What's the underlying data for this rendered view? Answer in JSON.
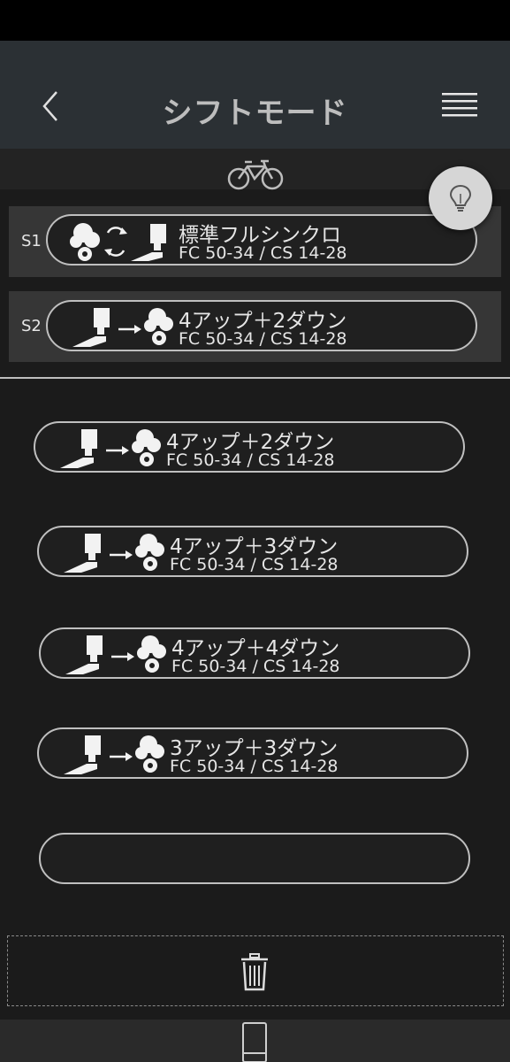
{
  "header": {
    "title": "シフトモード"
  },
  "icons": {
    "back": "chevron-left-icon",
    "menu": "menu-icon",
    "bike": "bicycle-icon",
    "hint": "lightbulb-icon",
    "trash": "trash-icon",
    "device": "phone-icon"
  },
  "slots": [
    {
      "label": "S1",
      "name": "標準フルシンクロ",
      "sub": "FC 50-34 / CS 14-28",
      "icon_style": "sync"
    },
    {
      "label": "S2",
      "name": "4アップ＋2ダウン",
      "sub": "FC 50-34 / CS 14-28",
      "icon_style": "arrow"
    }
  ],
  "modes": [
    {
      "name": "4アップ＋2ダウン",
      "sub": "FC 50-34 / CS 14-28"
    },
    {
      "name": "4アップ＋3ダウン",
      "sub": "FC 50-34 / CS 14-28"
    },
    {
      "name": "4アップ＋4ダウン",
      "sub": "FC 50-34 / CS 14-28"
    },
    {
      "name": "3アップ＋3ダウン",
      "sub": "FC 50-34 / CS 14-28"
    },
    {
      "name": "",
      "sub": ""
    }
  ],
  "colors": {
    "background": "#1b1b1b",
    "header": "#2b3034",
    "slot": "#363636",
    "pill_border": "#bfbfbf",
    "hint": "#d6d6d6"
  }
}
